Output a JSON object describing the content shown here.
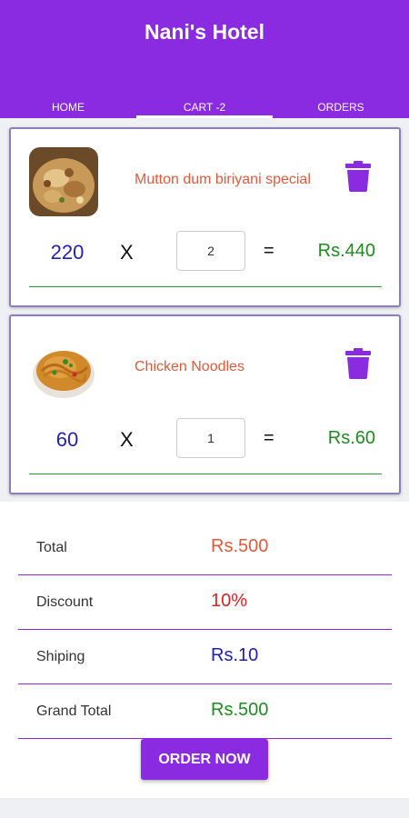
{
  "app": {
    "title": "Nani's Hotel"
  },
  "tabs": [
    {
      "label": "HOME"
    },
    {
      "label": "CART -2"
    },
    {
      "label": "ORDERS"
    }
  ],
  "cart": {
    "items": [
      {
        "name": "Mutton dum biriyani special",
        "price": "220",
        "times": "X",
        "qty": "2",
        "equals": "=",
        "subtotal": "Rs.440"
      },
      {
        "name": "Chicken Noodles",
        "price": "60",
        "times": "X",
        "qty": "1",
        "equals": "=",
        "subtotal": "Rs.60"
      }
    ]
  },
  "summary": {
    "total_label": "Total",
    "total_value": "Rs.500",
    "discount_label": "Discount",
    "discount_value": "10%",
    "shipping_label": "Shiping",
    "shipping_value": "Rs.10",
    "grand_label": "Grand Total",
    "grand_value": "Rs.500"
  },
  "order_button": "ORDER NOW",
  "colors": {
    "primary": "#8a2be2",
    "name": "#e05a3a",
    "price": "#2020b8",
    "subtotal": "#1e8c1e",
    "discount": "#dd2222"
  }
}
